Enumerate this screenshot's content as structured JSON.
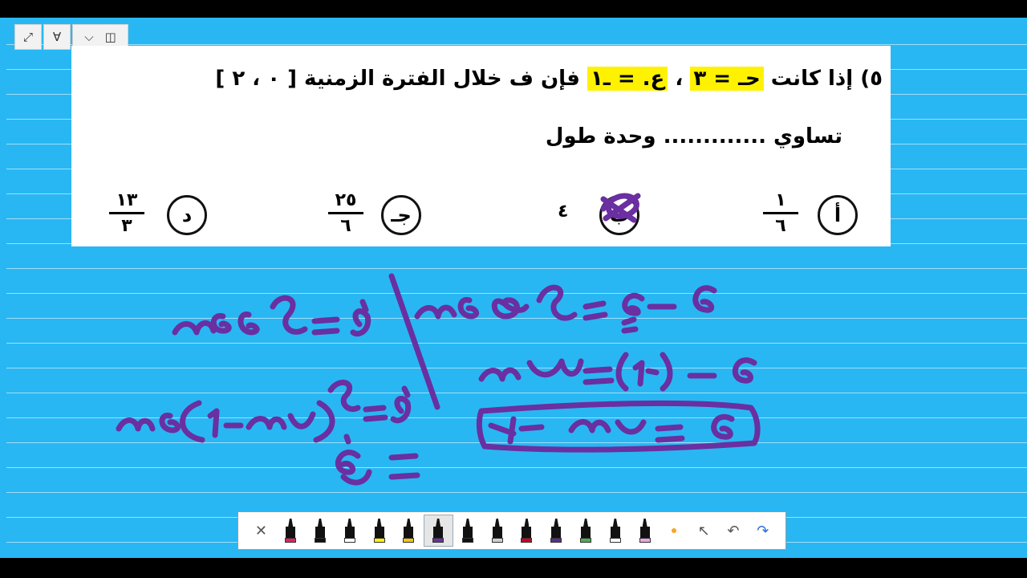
{
  "question": {
    "number_paren": "٥)",
    "line1_prefix": "إذا كانت",
    "eq1": "حـ = ٣",
    "sep": "،",
    "eq2": "ع. = ـ١",
    "line1_suffix": "فإن ف خلال الفترة الزمنية [ ٠ ، ٢ ]",
    "line2": "تساوي ............. وحدة طول",
    "options": [
      {
        "letter": "أ",
        "num": "١",
        "den": "٦"
      },
      {
        "letter": "ب",
        "value": "٤"
      },
      {
        "letter": "جـ",
        "num": "٢٥",
        "den": "٦"
      },
      {
        "letter": "د",
        "num": "١٣",
        "den": "٣"
      }
    ],
    "highlight_color": "#fff200"
  },
  "mini_toolbar": {
    "icons": [
      "expand-icon",
      "pin-icon",
      "chevron-down-icon",
      "book-icon"
    ]
  },
  "ink_color": "#6a2fa0",
  "pen_toolbar": {
    "tools": [
      {
        "name": "close-tool",
        "icon": "close-icon",
        "glyph": "✕"
      },
      {
        "name": "pen-red",
        "band": "#e0245e"
      },
      {
        "name": "pen-black-1",
        "band": "#111111"
      },
      {
        "name": "pen-white",
        "band": "#ffffff"
      },
      {
        "name": "highlighter-yellow",
        "band": "#fff200"
      },
      {
        "name": "pen-gold",
        "band": "#f0c419"
      },
      {
        "name": "pen-purple",
        "band": "#6a2fa0",
        "selected": true
      },
      {
        "name": "pen-black-2",
        "band": "#111111"
      },
      {
        "name": "pen-gray",
        "band": "#cfcfcf"
      },
      {
        "name": "pen-red-2",
        "band": "#d0021b"
      },
      {
        "name": "pen-purple-2",
        "band": "#5b2c8f"
      },
      {
        "name": "pen-green",
        "band": "#4caf50"
      },
      {
        "name": "pen-white-2",
        "band": "#ffffff"
      },
      {
        "name": "eraser-pink",
        "band": "#e8a6e0"
      },
      {
        "name": "dot-size",
        "icon": "dot-icon"
      },
      {
        "name": "pointer",
        "icon": "cursor-icon",
        "glyph": "↖"
      },
      {
        "name": "undo",
        "icon": "undo-icon",
        "glyph": "↶"
      },
      {
        "name": "redo",
        "icon": "redo-icon",
        "glyph": "↷"
      }
    ]
  }
}
